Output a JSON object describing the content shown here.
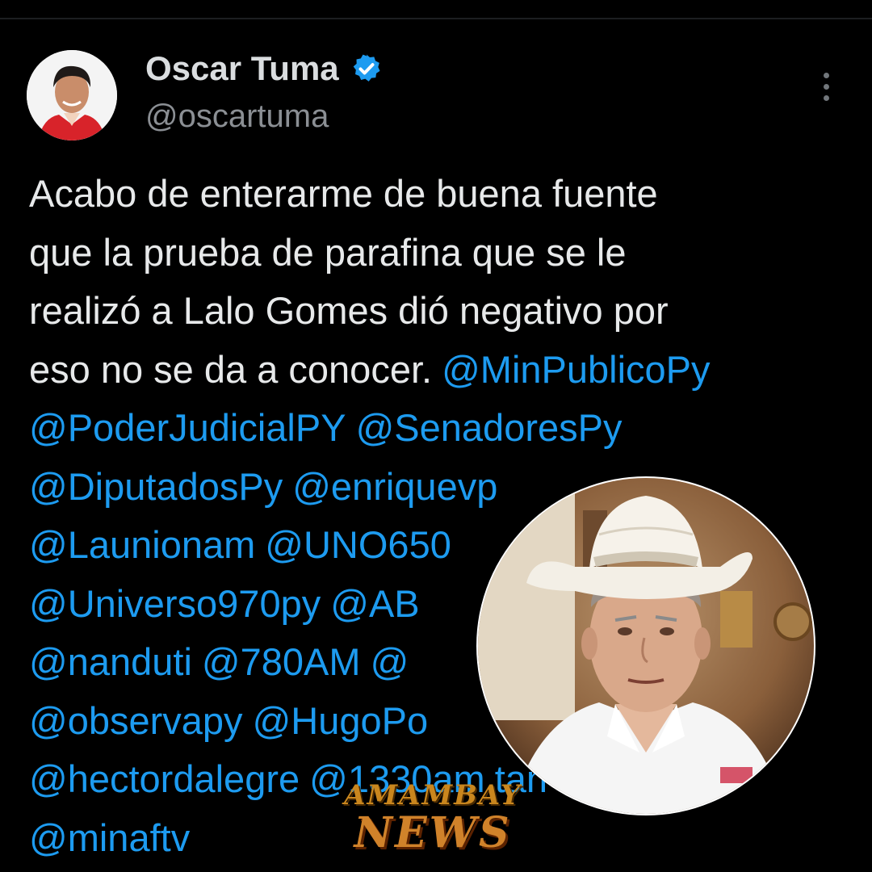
{
  "author": {
    "display_name": "Oscar Tuma",
    "handle": "@oscartuma",
    "verified": true,
    "verified_icon": "verified-badge-icon",
    "avatar_icon": "profile-avatar"
  },
  "tweet": {
    "lines": [
      [
        {
          "kind": "text",
          "value": "Acabo de enterarme de buena fuente"
        }
      ],
      [
        {
          "kind": "text",
          "value": "que la prueba de parafina que se le"
        }
      ],
      [
        {
          "kind": "text",
          "value": "realizó a Lalo Gomes dió negativo por"
        }
      ],
      [
        {
          "kind": "text",
          "value": "eso no se da a conocer."
        },
        {
          "kind": "mention",
          "value": "@MinPublicoPy"
        }
      ],
      [
        {
          "kind": "mention",
          "value": "@PoderJudicialPY"
        },
        {
          "kind": "mention",
          "value": "@SenadoresPy"
        }
      ],
      [
        {
          "kind": "mention",
          "value": "@DiputadosPy"
        },
        {
          "kind": "mention",
          "value": "@enriquevp"
        }
      ],
      [
        {
          "kind": "mention",
          "value": "@Launionam"
        },
        {
          "kind": "mention",
          "value": "@UNO650"
        }
      ],
      [
        {
          "kind": "mention",
          "value": "@Universo970py"
        },
        {
          "kind": "mention",
          "value": "@AB"
        }
      ],
      [
        {
          "kind": "mention",
          "value": "@nanduti"
        },
        {
          "kind": "mention",
          "value": "@780AM"
        },
        {
          "kind": "mention",
          "value": "@"
        }
      ],
      [
        {
          "kind": "mention",
          "value": "@observapy"
        },
        {
          "kind": "mention",
          "value": "@HugoPo"
        }
      ],
      [
        {
          "kind": "mention",
          "value": "@hectordalegre"
        },
        {
          "kind": "mention",
          "value": "@1330am"
        },
        {
          "kind": "mention",
          "value": "tan"
        }
      ],
      [
        {
          "kind": "mention",
          "value": "@minaftv"
        }
      ]
    ]
  },
  "overlay": {
    "photo": "portrait-cowboy-hat-photo"
  },
  "watermark": {
    "line1": "AMAMBAY",
    "line2": "NEWS"
  },
  "colors": {
    "background": "#000000",
    "text": "#e7e9ea",
    "mention": "#1d9bf0",
    "handle": "#8b8f94",
    "verified": "#1d9bf0"
  }
}
